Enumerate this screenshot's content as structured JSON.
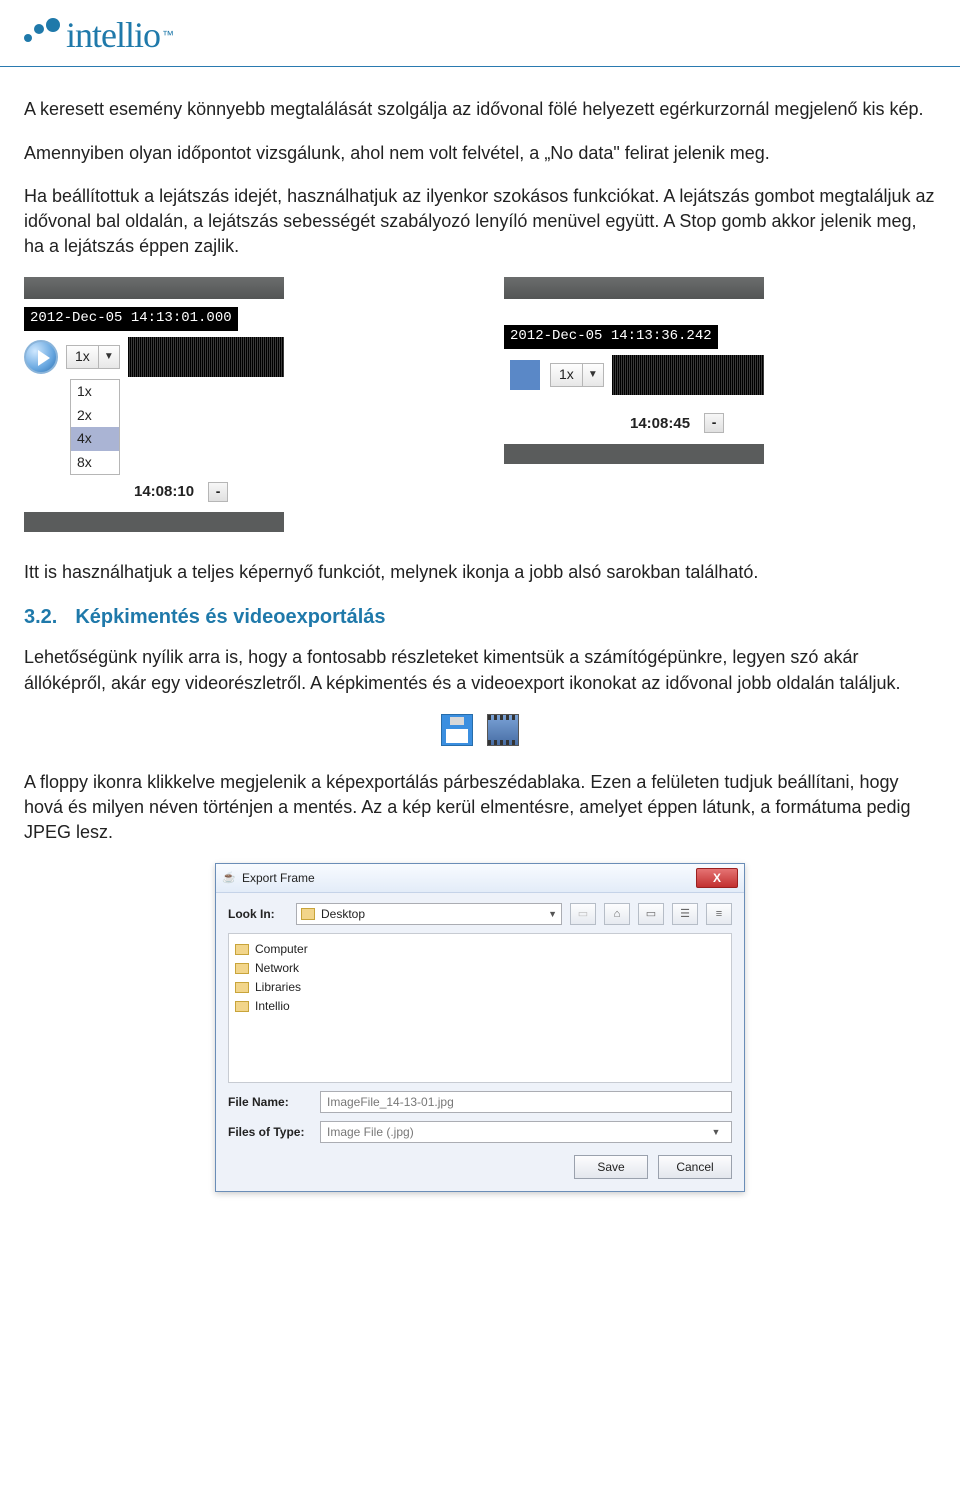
{
  "brand": {
    "name": "intellio",
    "tm": "™"
  },
  "paragraphs": {
    "p1": "A keresett esemény könnyebb megtalálását szolgálja az idővonal fölé helyezett egérkurzornál megjelenő kis kép.",
    "p2": "Amennyiben olyan időpontot vizsgálunk, ahol nem volt felvétel, a „No data\" felirat jelenik meg.",
    "p3": "Ha beállítottuk a lejátszás idejét, használhatjuk az ilyenkor szokásos funkciókat. A lejátszás gombot megtaláljuk az idővonal bal oldalán, a lejátszás sebességét szabályozó lenyíló menüvel együtt. A Stop gomb akkor jelenik meg, ha a lejátszás éppen zajlik.",
    "p4": "Itt is használhatjuk a teljes képernyő funkciót, melynek ikonja a jobb alsó sarokban található.",
    "p5": "Lehetőségünk nyílik arra is, hogy a fontosabb részleteket kimentsük a számítógépünkre, legyen szó akár állóképről, akár egy videorészletről. A képkimentés és a videoexport ikonokat az idővonal jobb oldalán találjuk.",
    "p6": "A floppy ikonra klikkelve megjelenik a képexportálás párbeszédablaka. Ezen a felületen tudjuk beállítani, hogy hová és milyen néven történjen a mentés. Az a kép kerül elmentésre, amelyet éppen látunk, a formátuma pedig JPEG lesz."
  },
  "section": {
    "number": "3.2.",
    "title": "Képkimentés és videoexportálás"
  },
  "panel_left": {
    "timestamp": "2012-Dec-05 14:13:01.000",
    "speed_selected": "1x",
    "speed_options": [
      "1x",
      "2x",
      "4x",
      "8x"
    ],
    "time": "14:08:10"
  },
  "panel_right": {
    "timestamp": "2012-Dec-05 14:13:36.242",
    "speed_selected": "1x",
    "time": "14:08:45"
  },
  "dialog": {
    "title": "Export Frame",
    "close": "X",
    "lookin_label": "Look In:",
    "lookin_value": "Desktop",
    "folders": [
      "Computer",
      "Network",
      "Libraries",
      "Intellio"
    ],
    "filename_label": "File Name:",
    "filename_value": "ImageFile_14-13-01.jpg",
    "filetype_label": "Files of Type:",
    "filetype_value": "Image File (.jpg)",
    "save_btn": "Save",
    "cancel_btn": "Cancel"
  }
}
